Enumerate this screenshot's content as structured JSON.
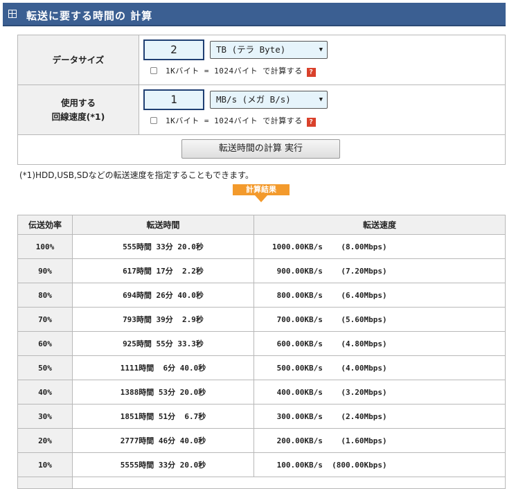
{
  "header": {
    "title": "転送に要する時間の 計算"
  },
  "form": {
    "data_size": {
      "label": "データサイズ",
      "value": "2",
      "unit": "TB (テラ Byte)",
      "checkbox_label": "1Kバイト = 1024バイト で計算する",
      "help": "?"
    },
    "speed": {
      "label_line1": "使用する",
      "label_line2": "回線速度(*1)",
      "value": "1",
      "unit": "MB/s (メガ B/s)",
      "checkbox_label": "1Kバイト = 1024バイト で計算する",
      "help": "?"
    },
    "submit_label": "転送時間の計算 実行"
  },
  "note": "(*1)HDD,USB,SDなどの転送速度を指定することもできます。",
  "result_badge": "計算結果",
  "table": {
    "headers": [
      "伝送効率",
      "転送時間",
      "転送速度"
    ],
    "rows": [
      {
        "eff": "100%",
        "time": "555時間 33分 20.0秒",
        "speed": "1000.00KB/s    (8.00Mbps)"
      },
      {
        "eff": "90%",
        "time": "617時間 17分  2.2秒",
        "speed": " 900.00KB/s    (7.20Mbps)"
      },
      {
        "eff": "80%",
        "time": "694時間 26分 40.0秒",
        "speed": " 800.00KB/s    (6.40Mbps)"
      },
      {
        "eff": "70%",
        "time": "793時間 39分  2.9秒",
        "speed": " 700.00KB/s    (5.60Mbps)"
      },
      {
        "eff": "60%",
        "time": "925時間 55分 33.3秒",
        "speed": " 600.00KB/s    (4.80Mbps)"
      },
      {
        "eff": "50%",
        "time": "1111時間  6分 40.0秒",
        "speed": " 500.00KB/s    (4.00Mbps)"
      },
      {
        "eff": "40%",
        "time": "1388時間 53分 20.0秒",
        "speed": " 400.00KB/s    (3.20Mbps)"
      },
      {
        "eff": "30%",
        "time": "1851時間 51分  6.7秒",
        "speed": " 300.00KB/s    (2.40Mbps)"
      },
      {
        "eff": "20%",
        "time": "2777時間 46分 40.0秒",
        "speed": " 200.00KB/s    (1.60Mbps)"
      },
      {
        "eff": "10%",
        "time": "5555時間 33分 20.0秒",
        "speed": " 100.00KB/s  (800.00Kbps)"
      }
    ]
  },
  "colors": {
    "header_bg": "#3b5f92",
    "badge": "#f39a2c",
    "help": "#d9412b",
    "input_bg": "#e6f4fb"
  }
}
